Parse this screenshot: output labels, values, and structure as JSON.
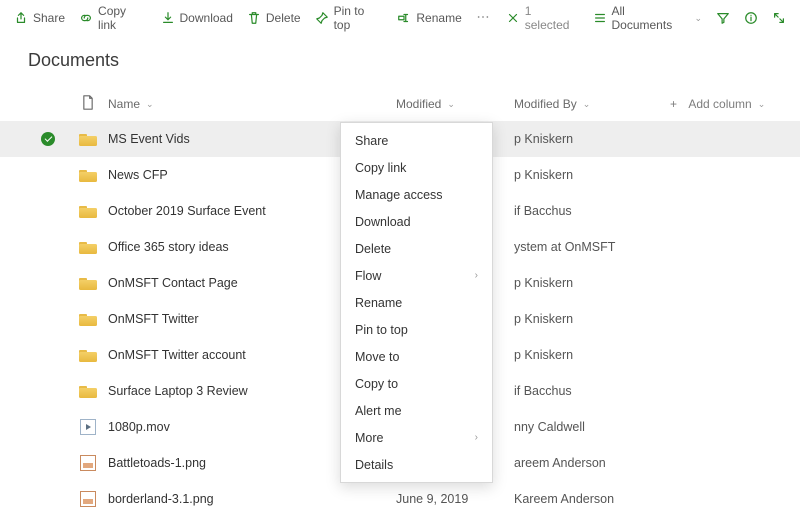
{
  "toolbar": {
    "share": "Share",
    "copylink": "Copy link",
    "download": "Download",
    "delete": "Delete",
    "pin": "Pin to top",
    "rename": "Rename",
    "selected": "1 selected",
    "view": "All Documents"
  },
  "page_title": "Documents",
  "columns": {
    "name": "Name",
    "modified": "Modified",
    "modified_by": "Modified By",
    "add": "Add column"
  },
  "rows": [
    {
      "type": "folder",
      "name": "MS Event Vids",
      "modified": "",
      "by": "p Kniskern",
      "selected": true
    },
    {
      "type": "folder",
      "name": "News CFP",
      "modified": "",
      "by": "p Kniskern"
    },
    {
      "type": "folder",
      "name": "October 2019 Surface Event",
      "modified": "",
      "by": "if Bacchus"
    },
    {
      "type": "folder",
      "name": "Office 365 story ideas",
      "modified": "",
      "by": "ystem at OnMSFT"
    },
    {
      "type": "folder",
      "name": "OnMSFT Contact Page",
      "modified": "",
      "by": "p Kniskern"
    },
    {
      "type": "folder",
      "name": "OnMSFT Twitter",
      "modified": "",
      "by": "p Kniskern"
    },
    {
      "type": "folder",
      "name": "OnMSFT Twitter account",
      "modified": "",
      "by": "p Kniskern"
    },
    {
      "type": "folder",
      "name": "Surface Laptop 3 Review",
      "modified": "",
      "by": "if Bacchus"
    },
    {
      "type": "video",
      "name": "1080p.mov",
      "modified": "",
      "by": "nny Caldwell"
    },
    {
      "type": "image",
      "name": "Battletoads-1.png",
      "modified": "",
      "by": "areem Anderson"
    },
    {
      "type": "image",
      "name": "borderland-3.1.png",
      "modified": "June 9, 2019",
      "by": "Kareem Anderson"
    }
  ],
  "context_menu": [
    {
      "label": "Share"
    },
    {
      "label": "Copy link"
    },
    {
      "label": "Manage access"
    },
    {
      "label": "Download"
    },
    {
      "label": "Delete"
    },
    {
      "label": "Flow",
      "sub": true
    },
    {
      "label": "Rename"
    },
    {
      "label": "Pin to top"
    },
    {
      "label": "Move to"
    },
    {
      "label": "Copy to"
    },
    {
      "label": "Alert me"
    },
    {
      "label": "More",
      "sub": true
    },
    {
      "label": "Details"
    }
  ]
}
